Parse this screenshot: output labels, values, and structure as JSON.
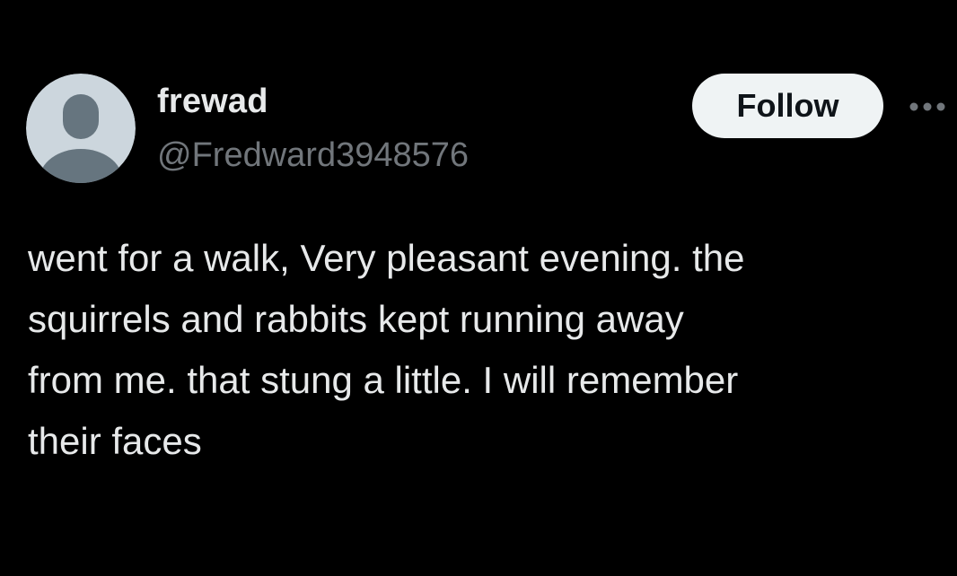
{
  "colors": {
    "background": "#000000",
    "primary_text": "#e7e9ea",
    "secondary_text": "#71767b",
    "follow_button_bg": "#eff3f4",
    "follow_button_text": "#0f1419",
    "avatar_bg": "#ccd6dd",
    "avatar_figure": "#66757f"
  },
  "author": {
    "display_name": "frewad",
    "handle": "@Fredward3948576",
    "avatar_icon": "default-profile-avatar-icon"
  },
  "actions": {
    "follow_label": "Follow",
    "more_icon": "more-horizontal-icon"
  },
  "tweet": {
    "lines": [
      "went for a walk, Very pleasant evening. the",
      "squirrels and rabbits kept running away",
      "from me. that stung a little. I will remember",
      "their faces"
    ]
  }
}
